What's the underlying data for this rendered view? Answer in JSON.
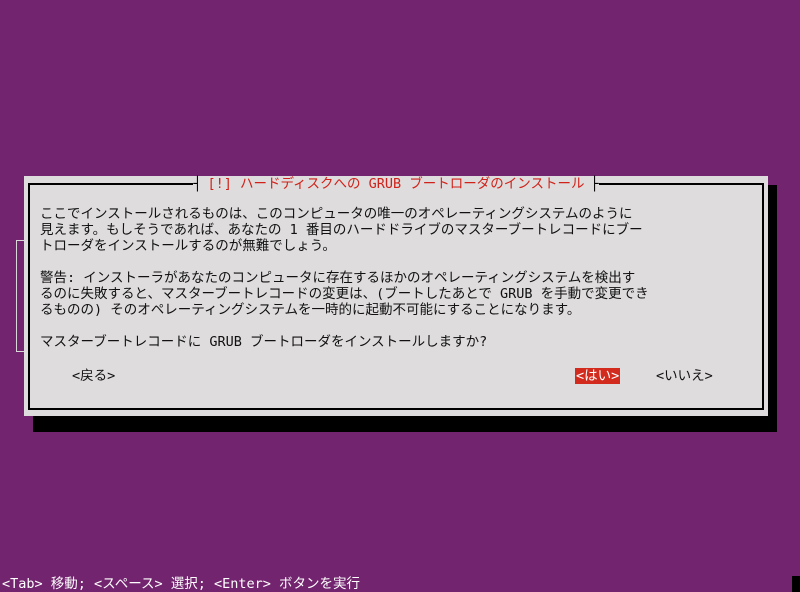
{
  "dialog": {
    "title": "[!] ハードディスクへの GRUB ブートローダのインストール",
    "lines_para1": [
      "ここでインストールされるものは、このコンピュータの唯一のオペレーティングシステムのように",
      "見えます。もしそうであれば、あなたの 1 番目のハードドライブのマスターブートレコードにブー",
      "トローダをインストールするのが無難でしょう。"
    ],
    "lines_para2": [
      "警告: インストーラがあなたのコンピュータに存在するほかのオペレーティングシステムを検出す",
      "るのに失敗すると、マスターブートレコードの変更は、(ブートしたあとで GRUB を手動で変更でき",
      "るものの) そのオペレーティングシステムを一時的に起動不可能にすることになります。"
    ],
    "question": "マスターブートレコードに GRUB ブートローダをインストールしますか?",
    "buttons": {
      "back": "<戻る>",
      "yes": "<はい>",
      "no": "<いいえ>"
    }
  },
  "statusbar": {
    "text": "<Tab> 移動; <スペース> 選択; <Enter> ボタンを実行"
  },
  "colors": {
    "background": "#73246f",
    "dialog_bg": "#dedcdc",
    "title_text": "#d0221a",
    "selected_button_bg": "#d22a1c"
  }
}
